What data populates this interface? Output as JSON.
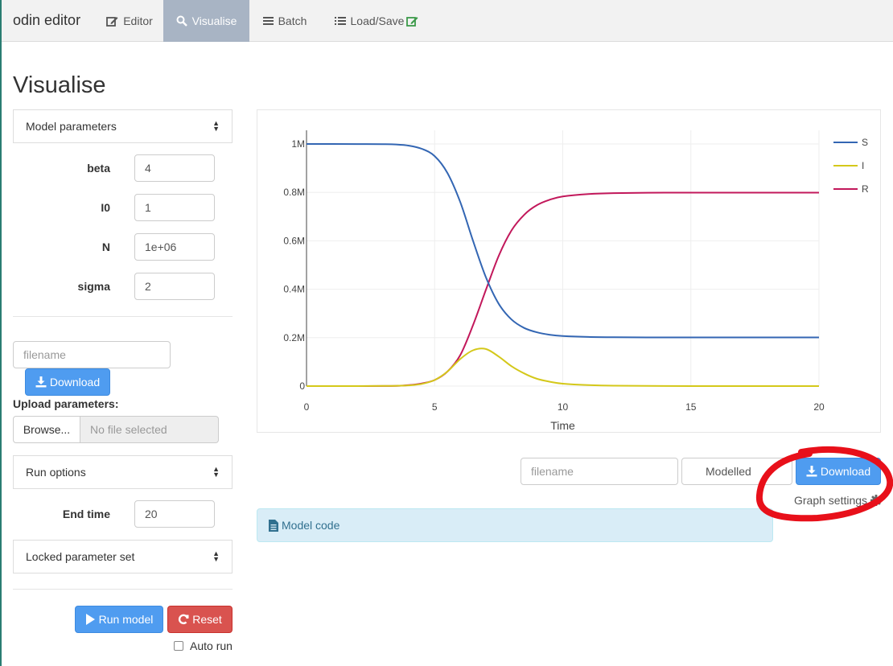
{
  "navbar": {
    "brand": "odin editor",
    "tabs": [
      {
        "label": "Editor",
        "icon": "edit-icon"
      },
      {
        "label": "Visualise",
        "icon": "search-icon",
        "active": true
      },
      {
        "label": "Batch",
        "icon": "list-icon"
      },
      {
        "label": "Load/Save",
        "icon": "list-icon"
      }
    ]
  },
  "page": {
    "title": "Visualise"
  },
  "sidebar": {
    "model_parameters_label": "Model parameters",
    "params": [
      {
        "name": "beta",
        "value": "4"
      },
      {
        "name": "I0",
        "value": "1"
      },
      {
        "name": "N",
        "value": "1e+06"
      },
      {
        "name": "sigma",
        "value": "2"
      }
    ],
    "filename_placeholder": "filename",
    "download_label": "Download",
    "upload_label": "Upload parameters:",
    "browse_label": "Browse...",
    "no_file_label": "No file selected",
    "run_options_label": "Run options",
    "end_time_label": "End time",
    "end_time_value": "20",
    "locked_label": "Locked parameter set",
    "run_model_label": "Run model",
    "reset_label": "Reset",
    "auto_run_label": "Auto run"
  },
  "plot_controls": {
    "filename_placeholder": "filename",
    "select_value": "Modelled",
    "download_label": "Download",
    "graph_settings_label": "Graph settings"
  },
  "model_code": {
    "label": "Model code"
  },
  "colors": {
    "S": "#3366b3",
    "I": "#d4c81a",
    "R": "#c2185b",
    "annotation": "#e8101a",
    "primary": "#4f9cf0"
  },
  "chart_data": {
    "type": "line",
    "xlabel": "Time",
    "ylabel": "",
    "xlim": [
      0,
      20
    ],
    "ylim": [
      0,
      1000000
    ],
    "x_ticks": [
      0,
      5,
      10,
      15,
      20
    ],
    "y_ticks": [
      0,
      200000,
      400000,
      600000,
      800000,
      1000000
    ],
    "y_tick_labels": [
      "0",
      "0.2M",
      "0.4M",
      "0.6M",
      "0.8M",
      "1M"
    ],
    "grid": true,
    "legend": "top-right",
    "x": [
      0,
      1,
      2,
      3,
      3.5,
      4,
      4.5,
      5,
      5.5,
      6,
      6.5,
      7,
      7.5,
      8,
      8.5,
      9,
      9.5,
      10,
      11,
      12,
      14,
      16,
      18,
      20
    ],
    "series": [
      {
        "name": "S",
        "values": [
          1000000,
          999950,
          999800,
          999200,
          998000,
          993000,
          980000,
          950000,
          880000,
          760000,
          600000,
          450000,
          340000,
          275000,
          240000,
          222000,
          212000,
          207000,
          203000,
          201500,
          201000,
          201000,
          201000,
          201000
        ]
      },
      {
        "name": "I",
        "values": [
          0,
          30,
          100,
          500,
          1200,
          3000,
          9000,
          25000,
          60000,
          112000,
          148000,
          153000,
          122000,
          82000,
          52000,
          30000,
          18000,
          10000,
          4000,
          1500,
          300,
          50,
          10,
          0
        ]
      },
      {
        "name": "R",
        "values": [
          0,
          20,
          100,
          300,
          800,
          4000,
          11000,
          25000,
          60000,
          128000,
          252000,
          397000,
          538000,
          643000,
          708000,
          748000,
          770000,
          783000,
          793000,
          797000,
          799000,
          799000,
          799000,
          799000
        ]
      }
    ]
  }
}
